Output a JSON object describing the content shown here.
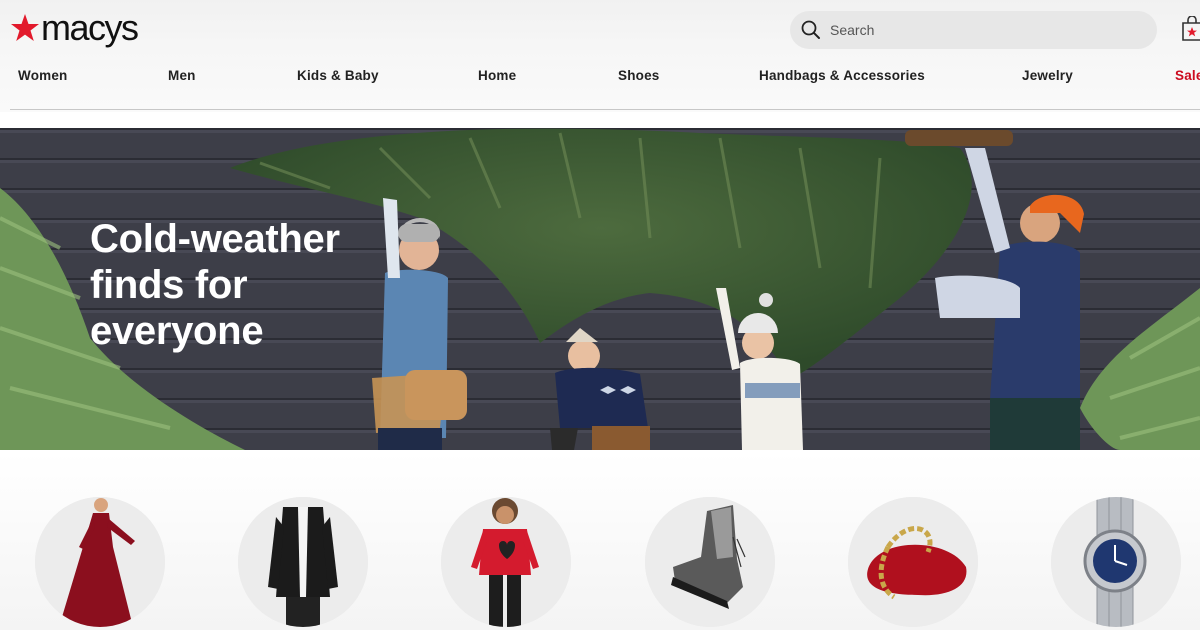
{
  "brand": {
    "name": "macys",
    "accent_color": "#e21a2c"
  },
  "search": {
    "placeholder": "Search",
    "icon": "search-icon"
  },
  "cart": {
    "icon": "shopping-bag-icon"
  },
  "nav": {
    "items": [
      {
        "label": "Women"
      },
      {
        "label": "Men"
      },
      {
        "label": "Kids & Baby"
      },
      {
        "label": "Home"
      },
      {
        "label": "Shoes"
      },
      {
        "label": "Handbags & Accessories"
      },
      {
        "label": "Jewelry"
      },
      {
        "label": "Sale"
      }
    ],
    "sale_color": "#cc0a1f"
  },
  "hero": {
    "headline": "Cold-weather\nfinds for\neveryone"
  },
  "categories": [
    {
      "icon": "red-velvet-dress-image"
    },
    {
      "icon": "black-coat-image"
    },
    {
      "icon": "kids-red-sweater-image"
    },
    {
      "icon": "silver-boot-image"
    },
    {
      "icon": "red-handbag-image"
    },
    {
      "icon": "watch-image"
    }
  ]
}
